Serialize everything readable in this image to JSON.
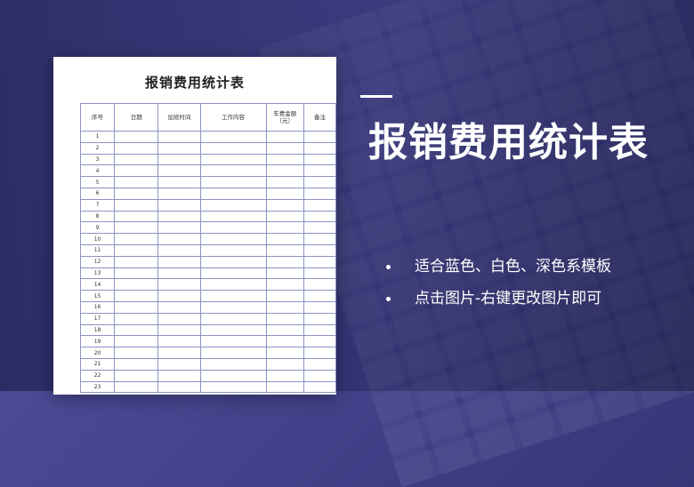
{
  "document": {
    "title": "报销费用统计表",
    "columns": [
      "序号",
      "日期",
      "加班时间",
      "工作内容",
      "车费金额（元）",
      "备注"
    ],
    "row_numbers": [
      "1",
      "2",
      "3",
      "4",
      "5",
      "6",
      "7",
      "8",
      "9",
      "10",
      "11",
      "12",
      "13",
      "14",
      "15",
      "16",
      "17",
      "18",
      "19",
      "20",
      "21",
      "22",
      "23"
    ]
  },
  "headline": {
    "title": "报销费用统计表"
  },
  "bullets": [
    "适合蓝色、白色、深色系模板",
    "点击图片-右键更改图片即可"
  ],
  "colors": {
    "background": "#45448d",
    "table_border": "#8a93c8",
    "text_light": "#ffffff"
  }
}
